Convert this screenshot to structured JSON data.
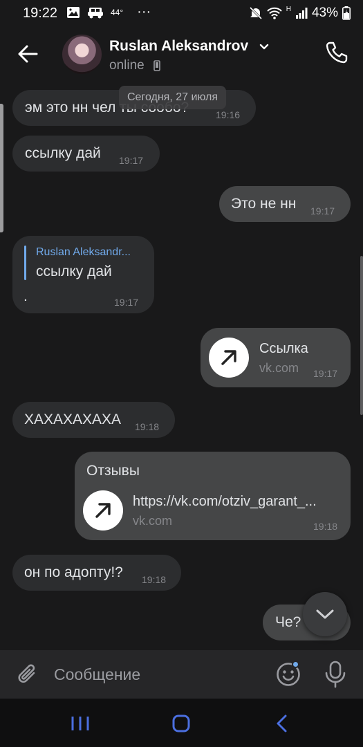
{
  "status_bar": {
    "time": "19:22",
    "temperature": "44°",
    "more": "···",
    "network": "H",
    "battery": "43%",
    "icons": [
      "image-icon",
      "car-icon",
      "mute-icon",
      "wifi-icon",
      "signal-icon",
      "battery-icon"
    ]
  },
  "header": {
    "name": "Ruslan Aleksandrov",
    "status": "online",
    "icons": [
      "back-arrow-icon",
      "chevron-down-icon",
      "mobile-device-icon",
      "phone-icon"
    ]
  },
  "date_chip": "Сегодня, 27 июля",
  "messages": [
    {
      "text": "эм это нн чел ты сообо?",
      "time": "19:16"
    },
    {
      "text": "ссылку дай",
      "time": "19:17"
    },
    {
      "text": "Это не нн",
      "time": "19:17"
    },
    {
      "reply_author": "Ruslan Aleksandr...",
      "reply_text": "ссылку дай",
      "text": ".",
      "time": "19:17"
    },
    {
      "link_title": "Ссылка",
      "link_domain": "vk.com",
      "time": "19:17"
    },
    {
      "text": "ХАХАХАХАХА",
      "time": "19:18"
    },
    {
      "text": "Отзывы",
      "link_title": "https://vk.com/otziv_garant_...",
      "link_domain": "vk.com",
      "time": "19:18"
    },
    {
      "text": "он по адопту!?",
      "time": "19:18"
    },
    {
      "text": "Че?"
    }
  ],
  "composer": {
    "placeholder": "Сообщение",
    "icons": [
      "paperclip-icon",
      "emoji-icon",
      "microphone-icon"
    ]
  },
  "colors": {
    "background": "#19191a",
    "incoming_bubble": "#2c2d2f",
    "outgoing_bubble": "#454647",
    "accent": "#71aaeb"
  }
}
